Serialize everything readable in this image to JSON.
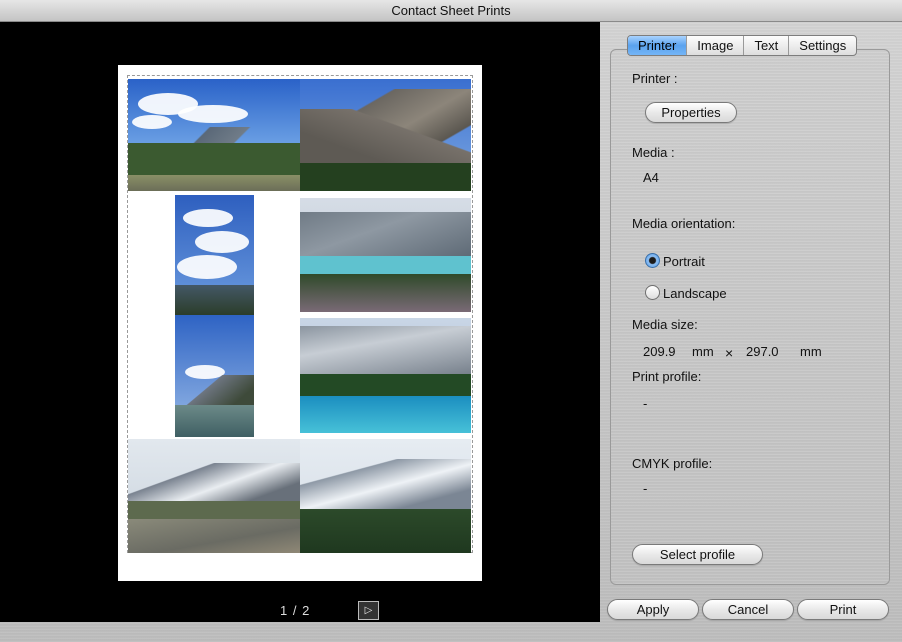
{
  "window": {
    "title": "Contact Sheet Prints"
  },
  "tabs": [
    {
      "label": "Printer",
      "active": true
    },
    {
      "label": "Image",
      "active": false
    },
    {
      "label": "Text",
      "active": false
    },
    {
      "label": "Settings",
      "active": false
    }
  ],
  "printer": {
    "printer_label": "Printer :",
    "properties_button": "Properties",
    "media_label": "Media :",
    "media_value": "A4",
    "orientation_label": "Media orientation:",
    "orientation_options": [
      {
        "label": "Portrait",
        "selected": true
      },
      {
        "label": "Landscape",
        "selected": false
      }
    ],
    "media_size_label": "Media size:",
    "width_value": "209.9",
    "width_unit": "mm",
    "size_separator": "×",
    "height_value": "297.0",
    "height_unit": "mm",
    "print_profile_label": "Print profile:",
    "print_profile_value": "-",
    "cmyk_profile_label": "CMYK profile:",
    "cmyk_profile_value": "-",
    "select_profile_button": "Select profile"
  },
  "pager": {
    "current": "1",
    "separator": "/",
    "total": "2",
    "next_icon": "▷"
  },
  "footer": {
    "apply": "Apply",
    "cancel": "Cancel",
    "print": "Print"
  },
  "colors": {
    "accent": "#5aa2ee",
    "preview_bg": "#000000",
    "lake": "#3fb4c8"
  },
  "thumbnails": [
    "mountain-meadow-road",
    "rocky-peak",
    "cloudy-sky-portrait",
    "turquoise-lake",
    "sky-over-lake-portrait",
    "moraine-lake",
    "glacier-highway",
    "snowy-range"
  ]
}
